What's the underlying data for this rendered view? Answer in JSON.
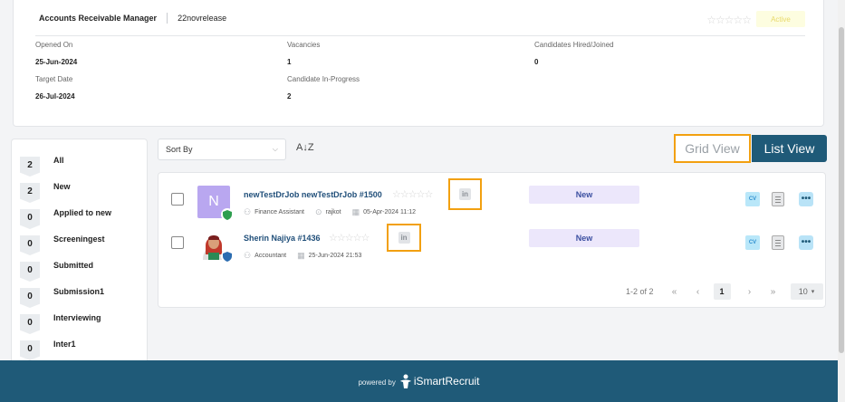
{
  "job": {
    "title": "Accounts Receivable Manager",
    "code": "22novrelease",
    "rating": "☆☆☆☆☆",
    "status": "Active",
    "opened_on_label": "Opened On",
    "opened_on": "25-Jun-2024",
    "vacancies_label": "Vacancies",
    "vacancies": "1",
    "hired_label": "Candidates Hired/Joined",
    "hired": "0",
    "target_date_label": "Target Date",
    "target_date": "26-Jul-2024",
    "in_progress_label": "Candidate In-Progress",
    "in_progress": "2"
  },
  "stages": [
    {
      "count": "2",
      "label": "All"
    },
    {
      "count": "2",
      "label": "New"
    },
    {
      "count": "0",
      "label": "Applied to new"
    },
    {
      "count": "0",
      "label": "Screeningest"
    },
    {
      "count": "0",
      "label": "Submitted"
    },
    {
      "count": "0",
      "label": "Submission1"
    },
    {
      "count": "0",
      "label": "Interviewing"
    },
    {
      "count": "0",
      "label": "Inter1"
    }
  ],
  "toolbar": {
    "sort_placeholder": "Sort By",
    "sort_icon": "A↓Z",
    "grid_view": "Grid View",
    "list_view": "List View"
  },
  "candidates": [
    {
      "initial": "N",
      "name": "newTestDrJob newTestDrJob #1500",
      "rating": "☆☆☆☆☆",
      "linkedin": "in",
      "designation": "Finance Assistant",
      "location": "rajkot",
      "date": "05-Apr-2024 11:12",
      "status": "New",
      "cv": "CV",
      "more": "•••"
    },
    {
      "initial": "",
      "name": "Sherin Najiya #1436",
      "rating": "☆☆☆☆☆",
      "linkedin": "in",
      "designation": "Accountant",
      "location": "",
      "date": "25-Jun-2024 21:53",
      "status": "New",
      "cv": "CV",
      "more": "•••"
    }
  ],
  "pagination": {
    "info": "1-2 of 2",
    "first": "«",
    "prev": "‹",
    "page": "1",
    "next": "›",
    "last": "»",
    "page_size": "10"
  },
  "footer": {
    "powered_by": "powered by",
    "brand": "iSmartRecruit"
  }
}
